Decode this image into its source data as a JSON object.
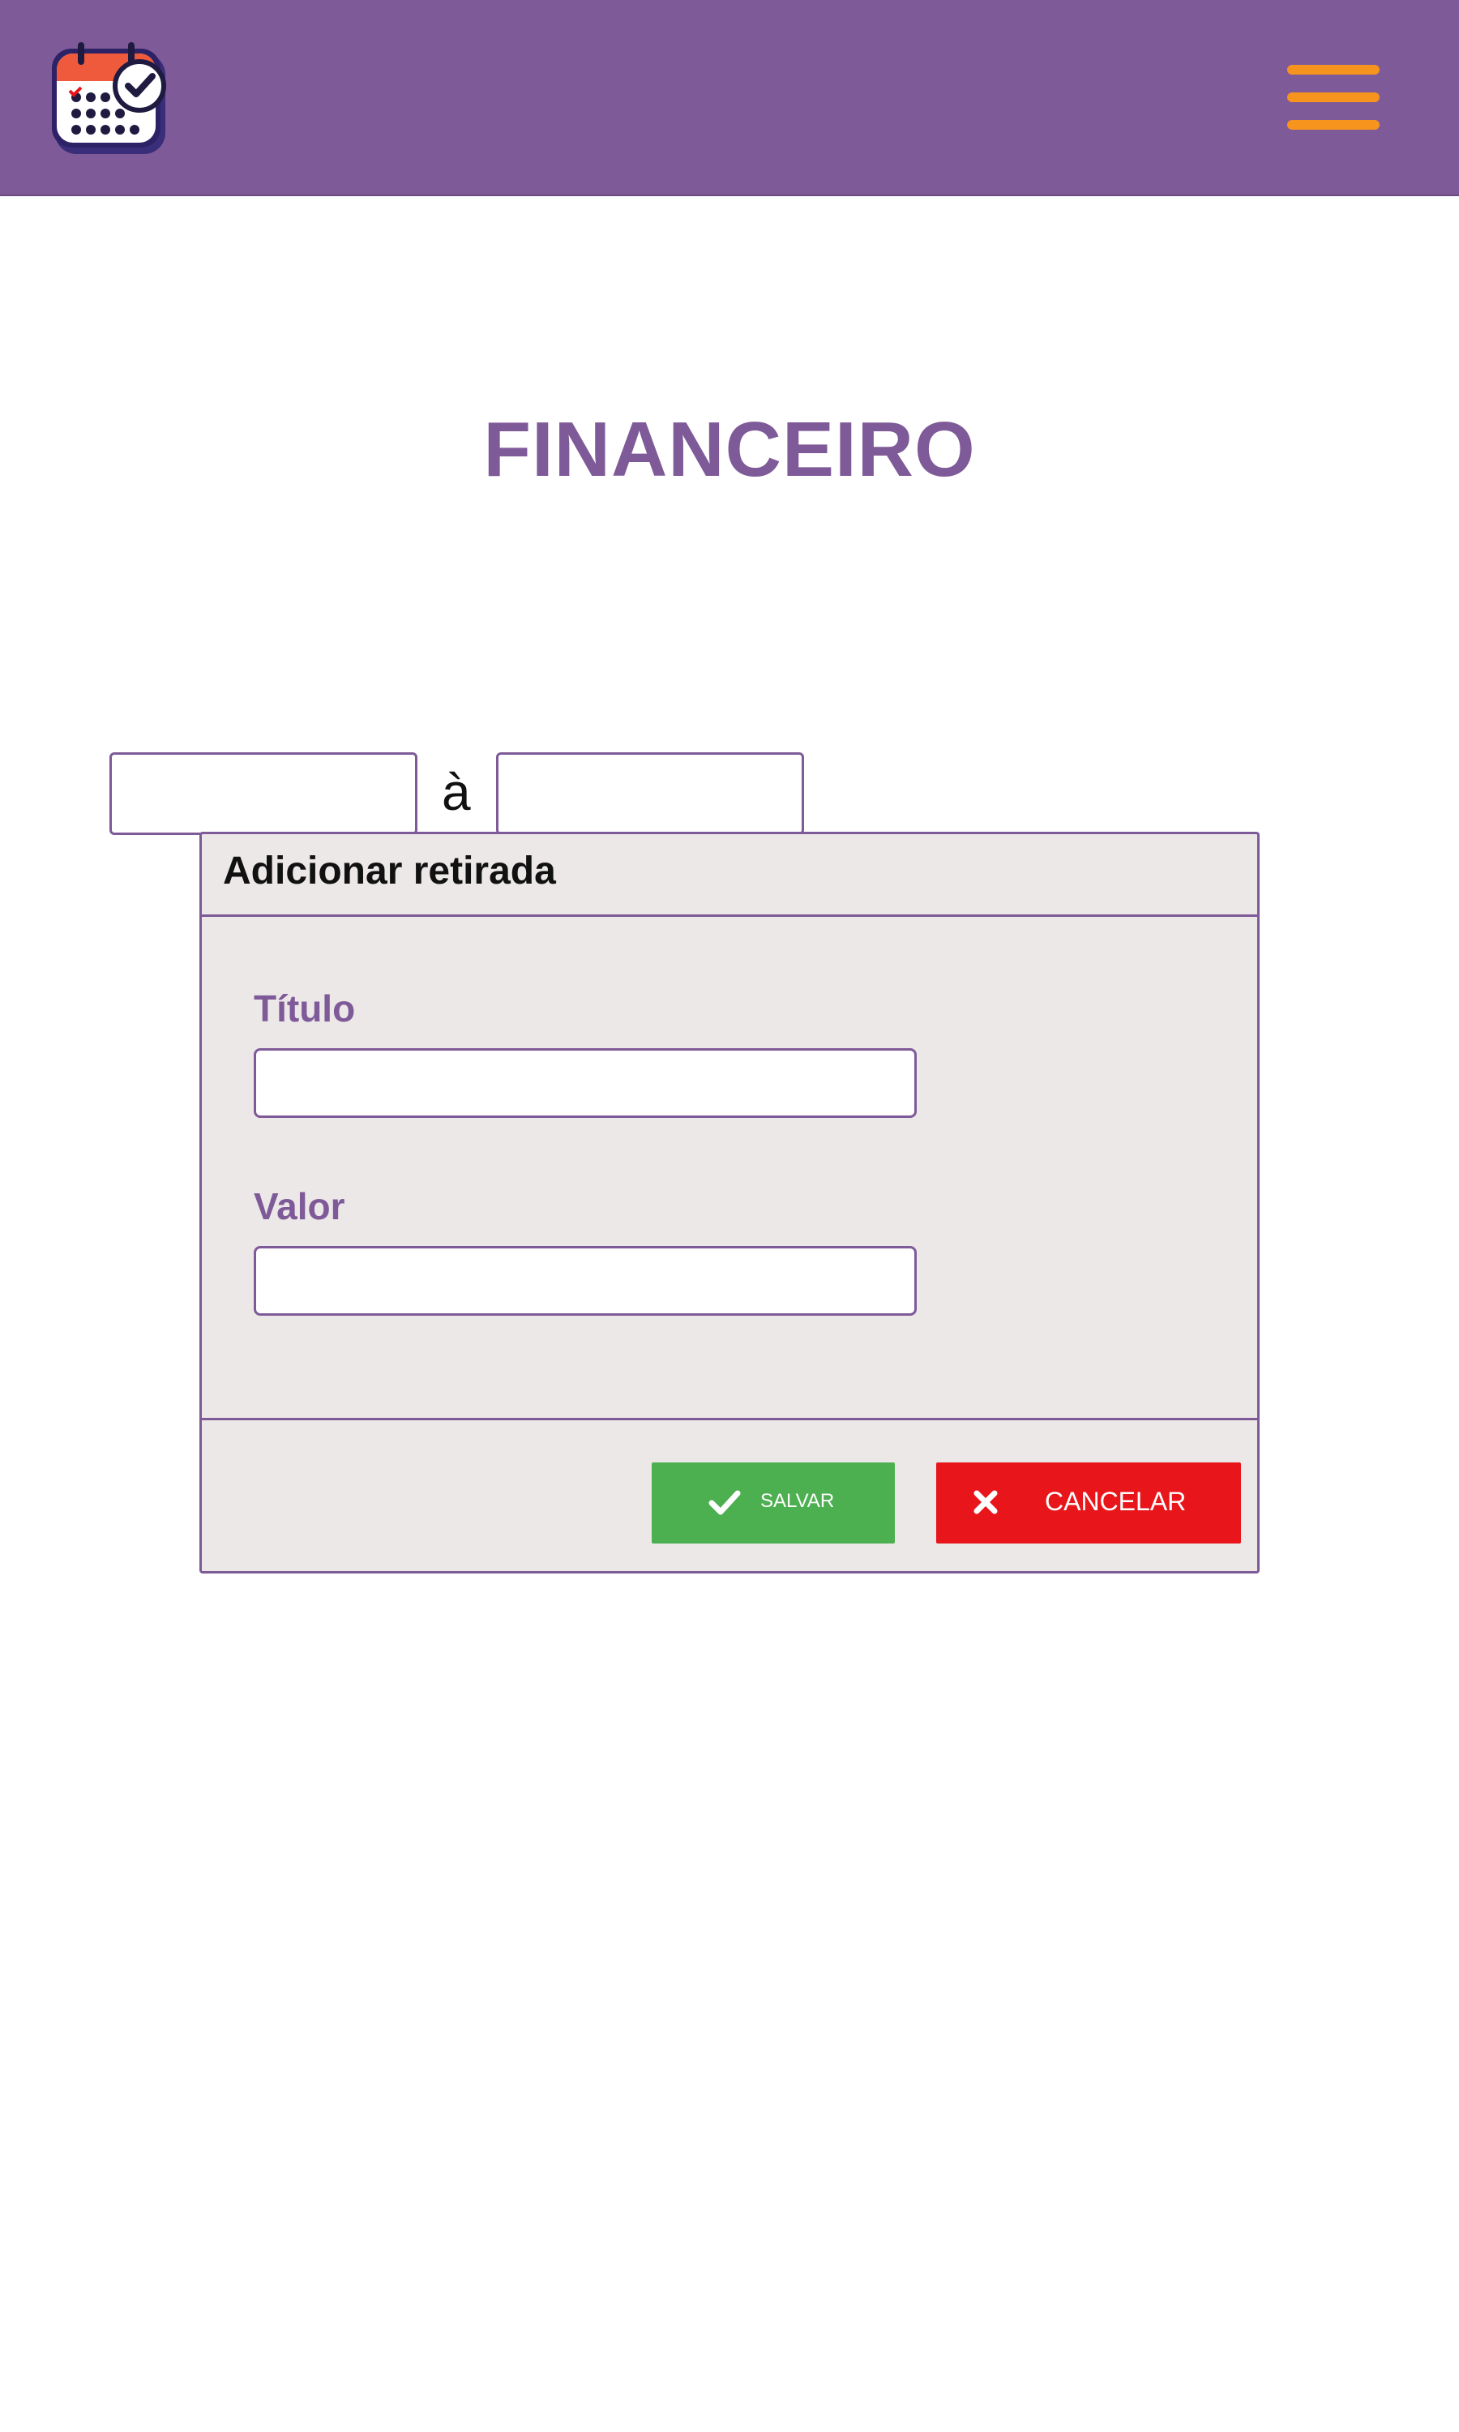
{
  "header": {
    "logo_icon": "calendar-check-icon",
    "menu_icon": "hamburger-menu-icon",
    "background_color": "#7f5a98",
    "menu_color": "#f7941d"
  },
  "page": {
    "title": "FINANCEIRO"
  },
  "date_range": {
    "from_value": "",
    "separator": "à",
    "to_value": ""
  },
  "modal": {
    "title": "Adicionar retirada",
    "fields": [
      {
        "label": "Título",
        "value": ""
      },
      {
        "label": "Valor",
        "value": ""
      }
    ],
    "buttons": {
      "save": {
        "label": "SALVAR",
        "icon": "check-icon",
        "color": "#4caf50"
      },
      "cancel": {
        "label": "CANCELAR",
        "icon": "close-icon",
        "color": "#e8151a"
      }
    }
  }
}
